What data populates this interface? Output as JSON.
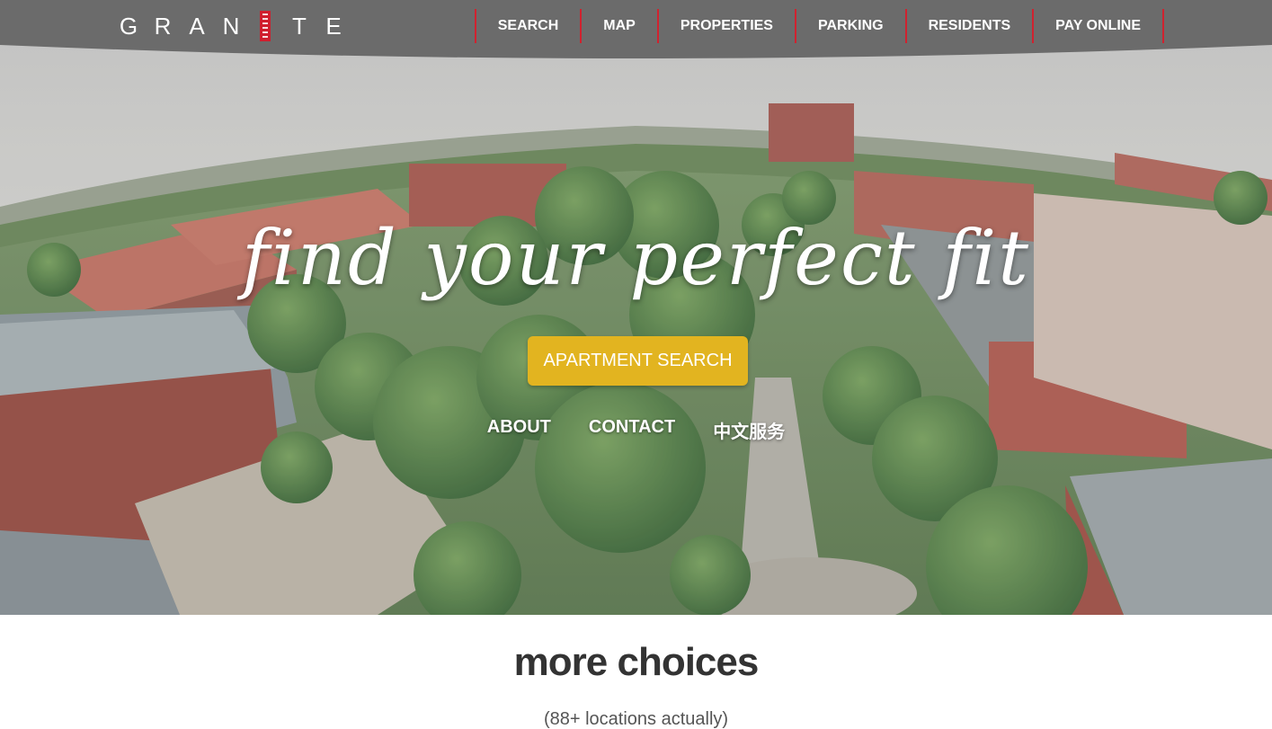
{
  "header": {
    "brand": {
      "letters_left": [
        "G",
        "R",
        "A",
        "N"
      ],
      "letters_right": [
        "T",
        "E"
      ]
    },
    "nav": [
      {
        "label": "SEARCH"
      },
      {
        "label": "MAP"
      },
      {
        "label": "PROPERTIES"
      },
      {
        "label": "PARKING"
      },
      {
        "label": "RESIDENTS"
      },
      {
        "label": "PAY ONLINE"
      }
    ]
  },
  "hero": {
    "tagline": "find your perfect fit",
    "cta_label": "APARTMENT SEARCH",
    "links": [
      {
        "label": "ABOUT"
      },
      {
        "label": "CONTACT"
      },
      {
        "label": "中文服务"
      }
    ]
  },
  "section": {
    "title": "more choices",
    "subtitle": "(88+ locations actually)"
  },
  "colors": {
    "header_bg": "#6b6b6b",
    "accent_red": "#d0222f",
    "cta_yellow": "#e2b420",
    "text_dark": "#333333"
  },
  "icons": {
    "logo_mark": "building-tower-icon"
  }
}
